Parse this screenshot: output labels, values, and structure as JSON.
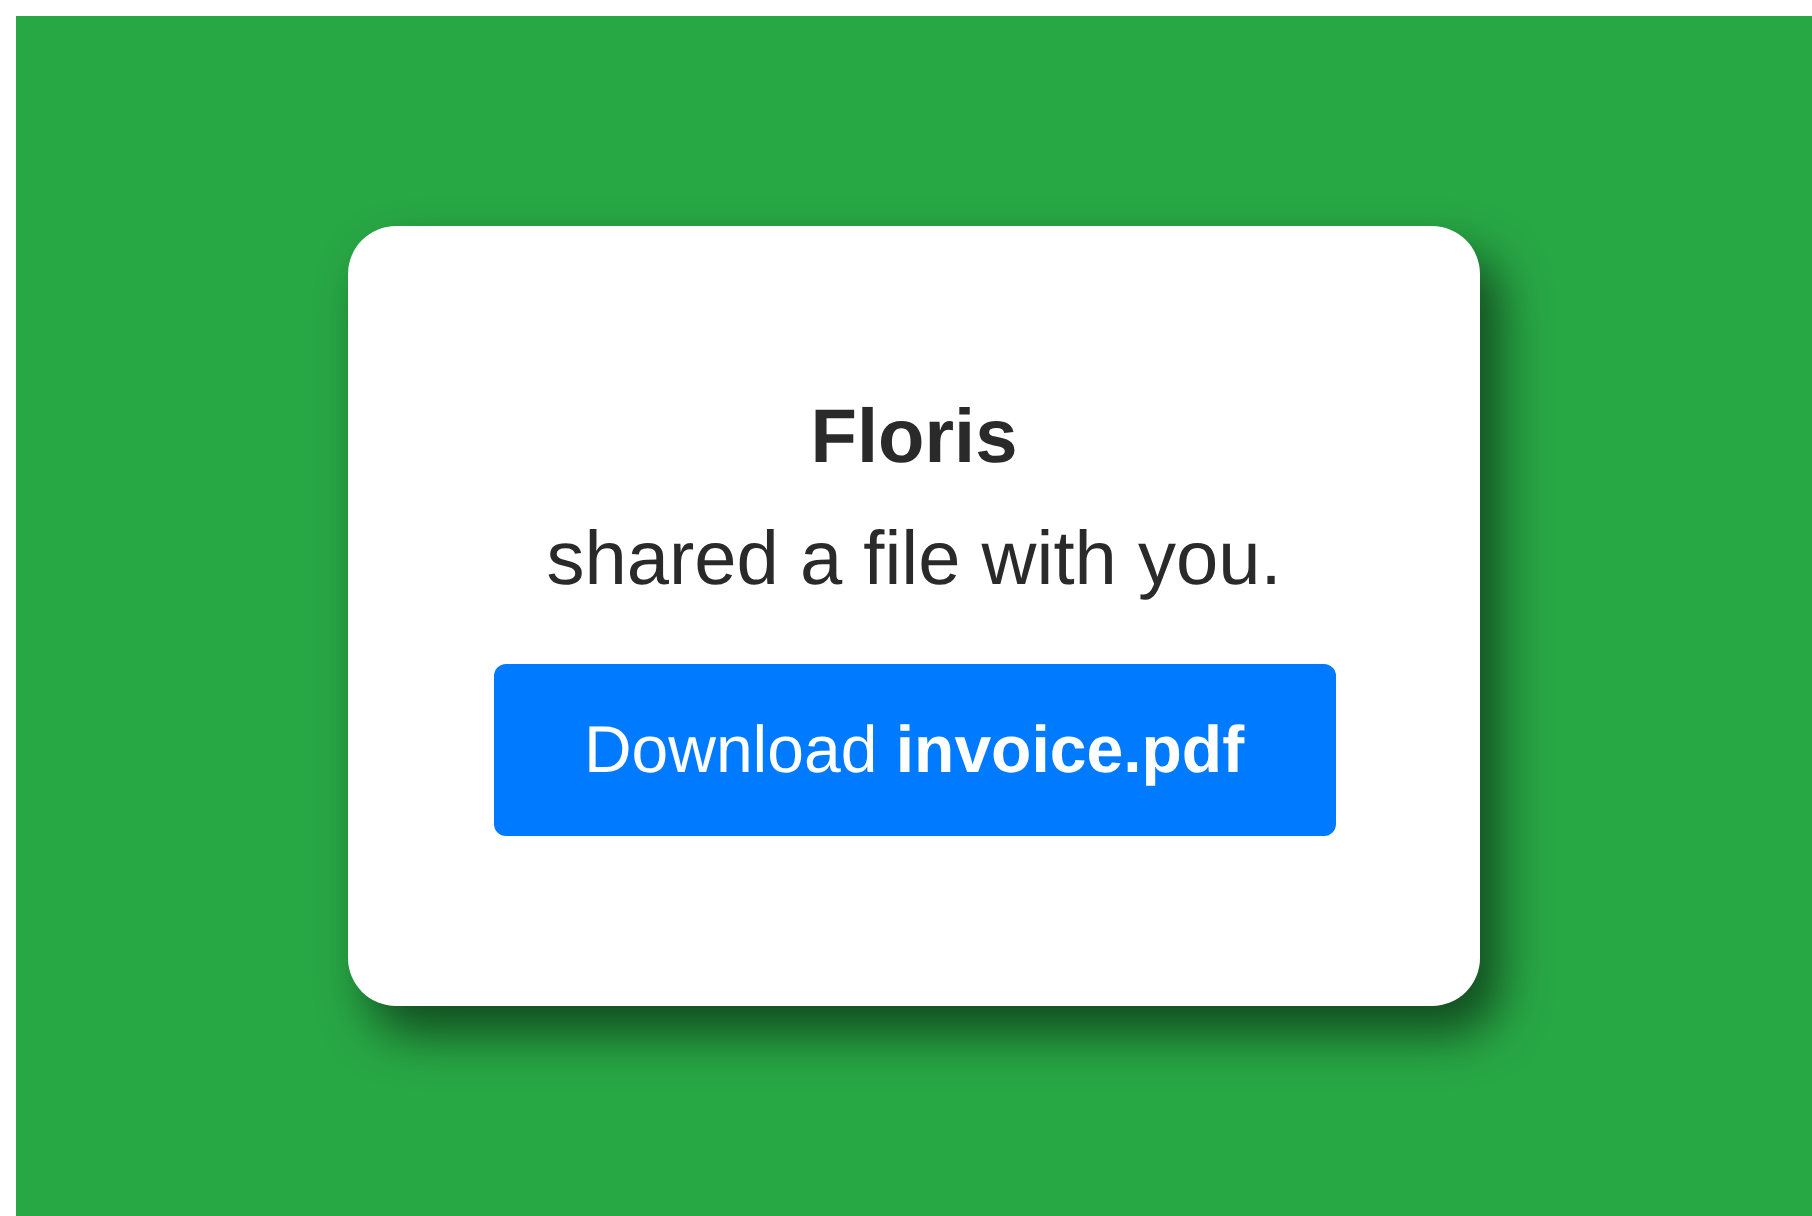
{
  "card": {
    "sender": "Floris",
    "message": "shared a file with you.",
    "button": "Download **invoice.pdf**"
  }
}
